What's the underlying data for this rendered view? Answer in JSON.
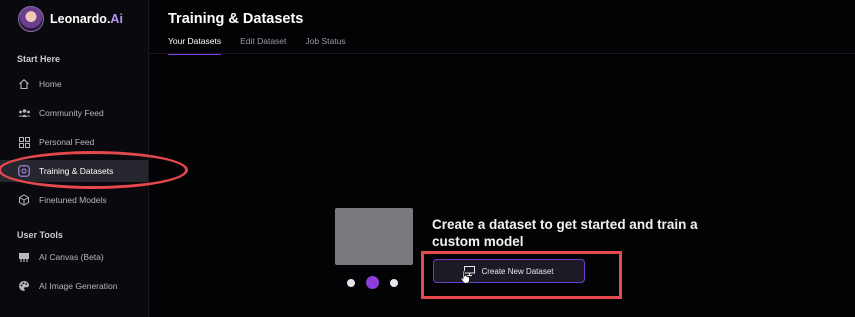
{
  "brand": {
    "name": "Leonardo.",
    "suffix": "Ai"
  },
  "sidebar": {
    "sections": [
      {
        "label": "Start Here"
      },
      {
        "label": "User Tools"
      }
    ],
    "items": [
      {
        "label": "Home",
        "icon": "home-icon"
      },
      {
        "label": "Community Feed",
        "icon": "users-icon"
      },
      {
        "label": "Personal Feed",
        "icon": "grid-icon"
      },
      {
        "label": "Training & Datasets",
        "icon": "training-icon",
        "active": true
      },
      {
        "label": "Finetuned Models",
        "icon": "cube-icon"
      },
      {
        "label": "AI Canvas (Beta)",
        "icon": "canvas-icon"
      },
      {
        "label": "AI Image Generation",
        "icon": "palette-icon"
      }
    ]
  },
  "header": {
    "title": "Training & Datasets",
    "tabs": [
      {
        "label": "Your Datasets",
        "active": true
      },
      {
        "label": "Edit Dataset"
      },
      {
        "label": "Job Status"
      }
    ]
  },
  "empty_state": {
    "heading": "Create a dataset to get started and train a custom model",
    "button_label": "Create New Dataset",
    "carousel_active_index": 1
  },
  "colors": {
    "accent": "#7c3aed",
    "annotation": "#e5484d"
  }
}
